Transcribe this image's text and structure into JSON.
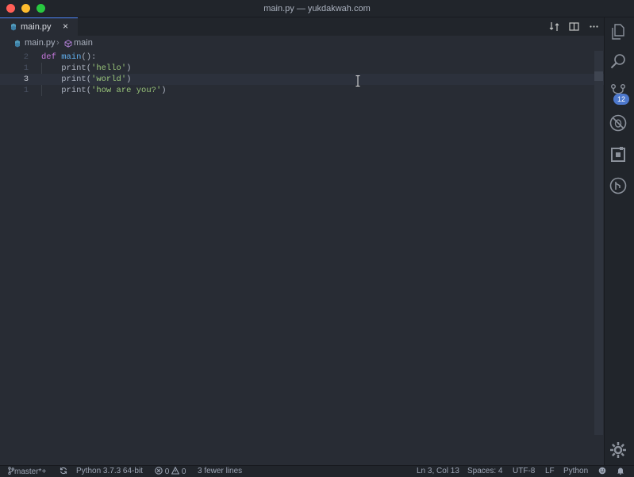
{
  "window": {
    "title": "main.py — yukdakwah.com"
  },
  "tab": {
    "label": "main.py",
    "close": "×"
  },
  "breadcrumb": {
    "file": "main.py",
    "separator": "›",
    "symbol": "main"
  },
  "editor": {
    "lines": [
      {
        "number": "2",
        "tokens": {
          "kw": "def",
          "fn": "main",
          "rest": "():"
        }
      },
      {
        "number": "1",
        "call": "print(",
        "str": "'hello'",
        "end": ")"
      },
      {
        "number": "3",
        "call": "print(",
        "str": "'world'",
        "end": ")",
        "active": true
      },
      {
        "number": "1",
        "call": "print(",
        "str": "'how are you?'",
        "end": ")"
      }
    ]
  },
  "activity": {
    "scm_badge": "12"
  },
  "status": {
    "branch": "master*+",
    "interpreter": "Python 3.7.3 64-bit",
    "errors": "0",
    "warnings": "0",
    "message": "3 fewer lines",
    "position": "Ln 3, Col 13",
    "spaces": "Spaces: 4",
    "encoding": "UTF-8",
    "eol": "LF",
    "language": "Python"
  },
  "colors": {
    "background": "#282c34",
    "keyword": "#c678dd",
    "function": "#61afef",
    "string": "#98c379",
    "badge": "#4d78cc"
  }
}
